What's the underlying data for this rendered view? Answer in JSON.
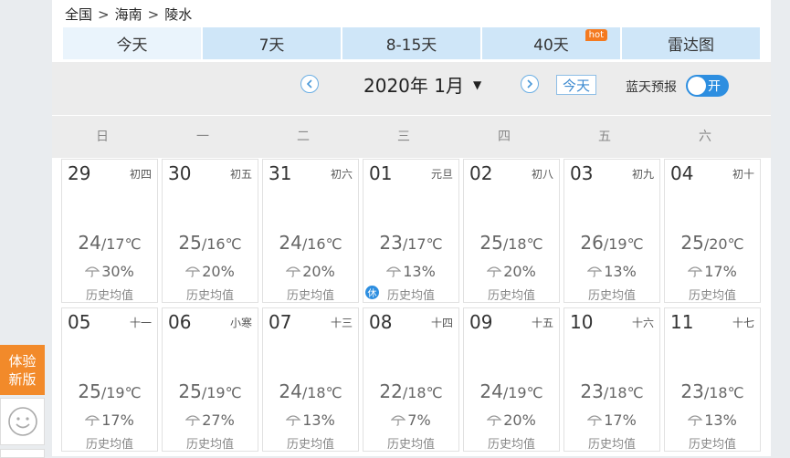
{
  "breadcrumb": {
    "items": [
      "全国",
      "海南",
      "陵水"
    ],
    "separator": ">"
  },
  "tabs": [
    {
      "label": "今天",
      "active": true
    },
    {
      "label": "7天",
      "active": false
    },
    {
      "label": "8-15天",
      "active": false
    },
    {
      "label": "40天",
      "active": false,
      "badge": "hot"
    },
    {
      "label": "雷达图",
      "active": false
    }
  ],
  "calendar_nav": {
    "prev_icon": "chevron-left-circle-icon",
    "next_icon": "chevron-right-circle-icon",
    "month_label": "2020年 1月",
    "caret": "▼",
    "today_button": "今天",
    "bluesky_label": "蓝天预报",
    "toggle_label": "开",
    "toggle_on": true
  },
  "weekdays": [
    "日",
    "一",
    "二",
    "三",
    "四",
    "五",
    "六"
  ],
  "history_label": "历史均值",
  "holiday_badge": "休",
  "days": [
    {
      "day": "29",
      "lunar": "初四",
      "hi": "24",
      "lo": "17℃",
      "rain": "30%"
    },
    {
      "day": "30",
      "lunar": "初五",
      "hi": "25",
      "lo": "16℃",
      "rain": "20%"
    },
    {
      "day": "31",
      "lunar": "初六",
      "hi": "24",
      "lo": "16℃",
      "rain": "20%"
    },
    {
      "day": "01",
      "lunar": "元旦",
      "hi": "23",
      "lo": "17℃",
      "rain": "13%",
      "holiday": true
    },
    {
      "day": "02",
      "lunar": "初八",
      "hi": "25",
      "lo": "18℃",
      "rain": "20%"
    },
    {
      "day": "03",
      "lunar": "初九",
      "hi": "26",
      "lo": "19℃",
      "rain": "13%"
    },
    {
      "day": "04",
      "lunar": "初十",
      "hi": "25",
      "lo": "20℃",
      "rain": "17%"
    },
    {
      "day": "05",
      "lunar": "十一",
      "hi": "25",
      "lo": "19℃",
      "rain": "17%"
    },
    {
      "day": "06",
      "lunar": "小寒",
      "hi": "25",
      "lo": "19℃",
      "rain": "27%"
    },
    {
      "day": "07",
      "lunar": "十三",
      "hi": "24",
      "lo": "18℃",
      "rain": "13%"
    },
    {
      "day": "08",
      "lunar": "十四",
      "hi": "22",
      "lo": "18℃",
      "rain": "7%"
    },
    {
      "day": "09",
      "lunar": "十五",
      "hi": "24",
      "lo": "19℃",
      "rain": "20%"
    },
    {
      "day": "10",
      "lunar": "十六",
      "hi": "23",
      "lo": "18℃",
      "rain": "17%"
    },
    {
      "day": "11",
      "lunar": "十七",
      "hi": "23",
      "lo": "18℃",
      "rain": "13%"
    }
  ],
  "side": {
    "try_line1": "体验",
    "try_line2": "新版",
    "feedback_icon": "smiley-icon"
  },
  "colors": {
    "accent": "#2d8ee0",
    "tab_bg": "#cfe6f8",
    "hot_badge": "#f47a20",
    "side_try": "#f28a2a"
  }
}
